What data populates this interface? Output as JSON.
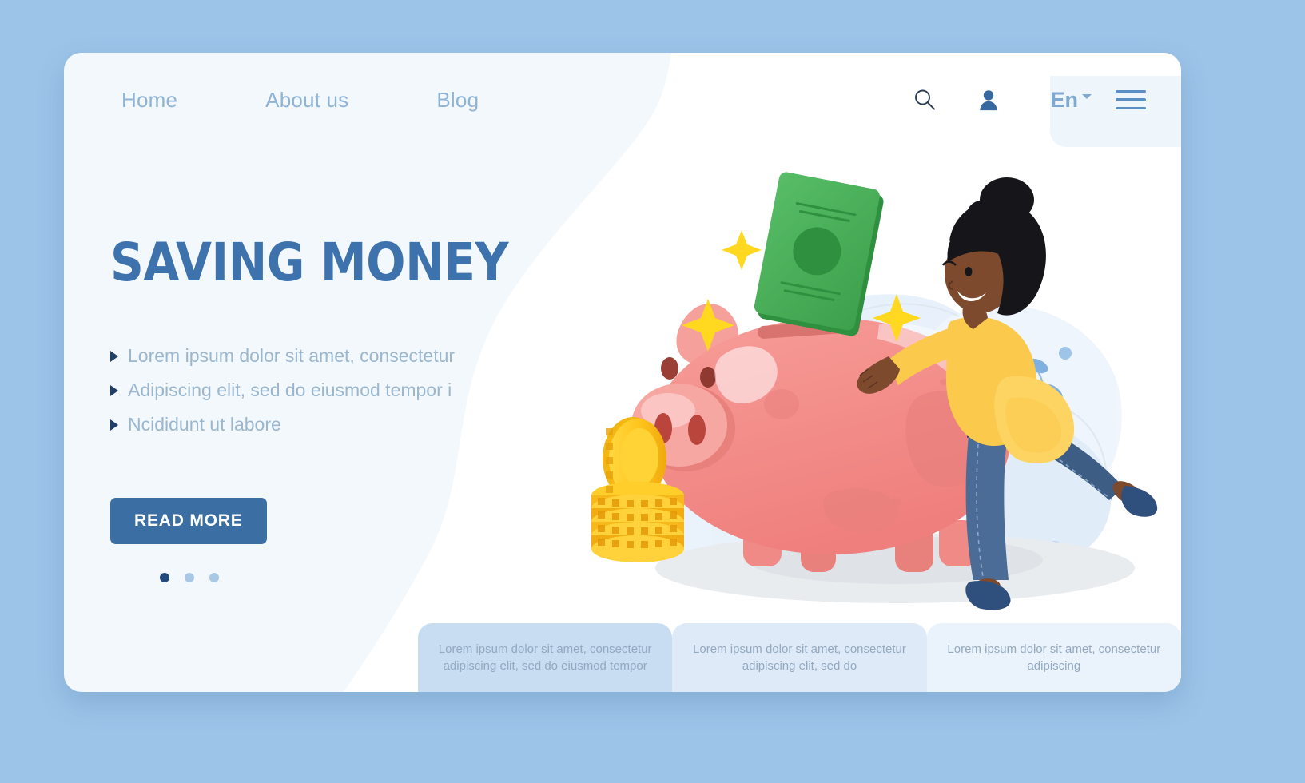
{
  "page": {
    "background_color": "#9cc4e8",
    "card_background": "#f3f8fc"
  },
  "nav": {
    "links": [
      {
        "label": "Home",
        "name": "nav-link-home"
      },
      {
        "label": "About us",
        "name": "nav-link-about-us"
      },
      {
        "label": "Blog",
        "name": "nav-link-blog"
      }
    ],
    "icons": [
      {
        "name": "search-icon",
        "glyph": "search"
      },
      {
        "name": "user-account-icon",
        "glyph": "user"
      }
    ],
    "language": {
      "label": "En",
      "caret": "dropdown-caret"
    },
    "menu": {
      "name": "hamburger-menu-icon"
    }
  },
  "hero": {
    "title": "SAVING MONEY",
    "title_color": "#3d72ad",
    "bullets": [
      "Lorem ipsum dolor sit amet, consectetur",
      "Adipiscing elit, sed do eiusmod tempor i",
      "Ncididunt ut labore"
    ],
    "cta": {
      "label": "READ MORE",
      "bg_color": "#3b6fa4",
      "text_color": "#ffffff"
    },
    "carousel": {
      "total": 3,
      "active_index": 0,
      "active_color": "#23497b",
      "inactive_color": "#a9c8e6"
    }
  },
  "bottom_cards": [
    {
      "text": "Lorem ipsum dolor sit amet, consectetur adipiscing elit, sed do eiusmod tempor",
      "bg_color": "#c8dcf2"
    },
    {
      "text": "Lorem ipsum dolor sit amet, consectetur adipiscing elit, sed do",
      "bg_color": "#dfeaf8"
    },
    {
      "text": "Lorem ipsum dolor sit amet, consectetur adipiscing",
      "bg_color": "#eaf2fb"
    }
  ],
  "illustration": {
    "name": "saving-money-illustration",
    "elements": [
      "piggy-bank",
      "banknote",
      "coin-stack",
      "woman-character",
      "sparkles",
      "leaf-plants",
      "blue-blobs"
    ],
    "colors": {
      "piggy_bank": "#f4908e",
      "banknote": "#4cb05a",
      "coins": "#ffc61e",
      "sweater": "#fbc94b",
      "jeans": "#4a6c96",
      "hair": "#16161a",
      "skin": "#7d4a2e",
      "sparkle": "#ffd81f"
    }
  }
}
